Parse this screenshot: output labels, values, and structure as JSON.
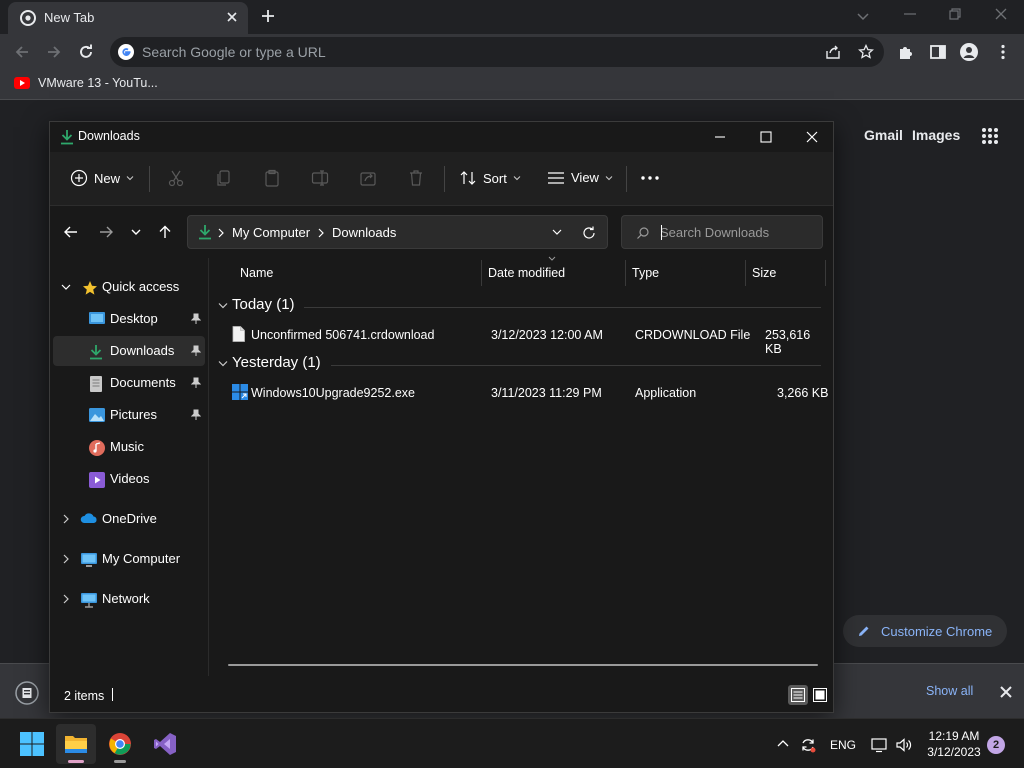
{
  "browser": {
    "tab": {
      "title": "New Tab"
    },
    "omnibox": {
      "placeholder": "Search Google or type a URL"
    },
    "bookmarks": [
      {
        "label": "VMware 13 - YouTu..."
      }
    ],
    "ntp": {
      "gmail": "Gmail",
      "images": "Images",
      "customize": "Customize Chrome"
    },
    "download_bar": {
      "show_all": "Show all"
    }
  },
  "explorer": {
    "title": "Downloads",
    "commands": {
      "new": "New",
      "sort": "Sort",
      "view": "View"
    },
    "address": {
      "crumbs": [
        "My Computer",
        "Downloads"
      ]
    },
    "search": {
      "placeholder": "Search Downloads"
    },
    "nav": {
      "quick_access": "Quick access",
      "items": [
        {
          "label": "Desktop",
          "pinned": true
        },
        {
          "label": "Downloads",
          "pinned": true,
          "selected": true
        },
        {
          "label": "Documents",
          "pinned": true
        },
        {
          "label": "Pictures",
          "pinned": true
        },
        {
          "label": "Music",
          "pinned": false
        },
        {
          "label": "Videos",
          "pinned": false
        }
      ],
      "onedrive": "OneDrive",
      "my_computer": "My Computer",
      "network": "Network"
    },
    "columns": [
      "Name",
      "Date modified",
      "Type",
      "Size"
    ],
    "groups": [
      {
        "label": "Today (1)",
        "files": [
          {
            "name": "Unconfirmed 506741.crdownload",
            "date": "3/12/2023 12:00 AM",
            "type": "CRDOWNLOAD File",
            "size": "253,616 KB",
            "icon": "document-icon"
          }
        ]
      },
      {
        "label": "Yesterday (1)",
        "files": [
          {
            "name": "Windows10Upgrade9252.exe",
            "date": "3/11/2023 11:29 PM",
            "type": "Application",
            "size": "3,266 KB",
            "icon": "windows-app-icon"
          }
        ]
      }
    ],
    "status": "2 items"
  },
  "taskbar": {
    "language": "ENG",
    "time": "12:19 AM",
    "date": "3/12/2023",
    "notifications": "2"
  },
  "colors": {
    "accent_blue": "#8ab4f8",
    "downloads_green": "#2ea86b",
    "chrome_dark": "#202124"
  }
}
